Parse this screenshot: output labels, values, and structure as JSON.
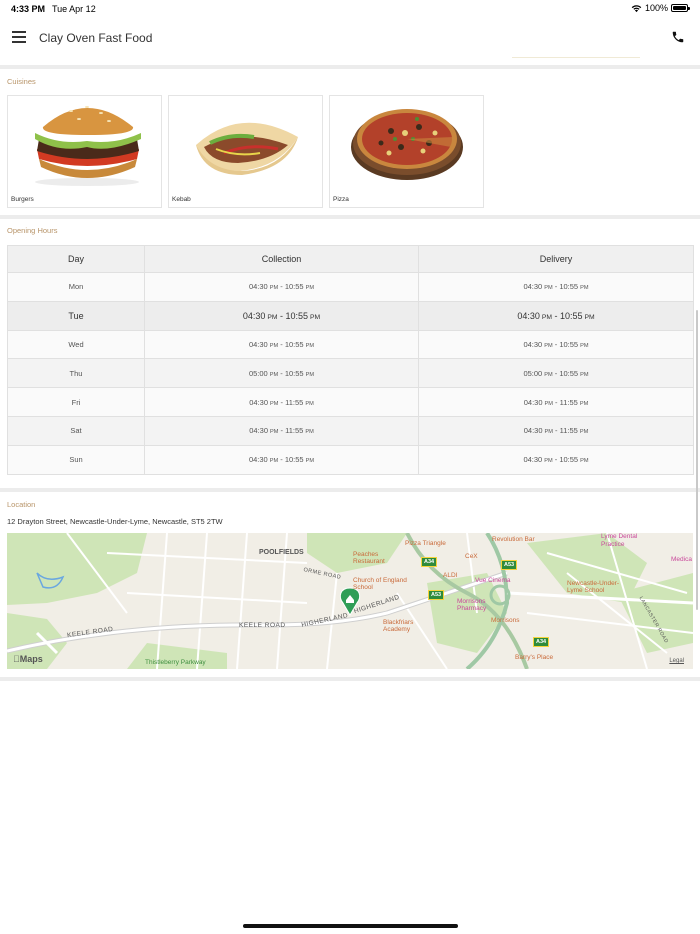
{
  "status_bar": {
    "time": "4:33 PM",
    "date": "Tue Apr 12",
    "battery": "100%"
  },
  "header": {
    "title": "Clay Oven Fast Food",
    "menu_icon": "hamburger-menu-icon",
    "phone_icon": "phone-icon"
  },
  "cuisines": {
    "label": "Cuisines",
    "items": [
      {
        "name": "Burgers",
        "icon": "burger-image"
      },
      {
        "name": "Kebab",
        "icon": "kebab-image"
      },
      {
        "name": "Pizza",
        "icon": "pizza-image"
      }
    ]
  },
  "opening_hours": {
    "label": "Opening Hours",
    "columns": [
      "Day",
      "Collection",
      "Delivery"
    ],
    "rows": [
      {
        "day": "Mon",
        "col_open": "04:30",
        "col_close": "10:55",
        "del_open": "04:30",
        "del_close": "10:55"
      },
      {
        "day": "Tue",
        "col_open": "04:30",
        "col_close": "10:55",
        "del_open": "04:30",
        "del_close": "10:55"
      },
      {
        "day": "Wed",
        "col_open": "04:30",
        "col_close": "10:55",
        "del_open": "04:30",
        "del_close": "10:55"
      },
      {
        "day": "Thu",
        "col_open": "05:00",
        "col_close": "10:55",
        "del_open": "05:00",
        "del_close": "10:55"
      },
      {
        "day": "Fri",
        "col_open": "04:30",
        "col_close": "11:55",
        "del_open": "04:30",
        "del_close": "11:55"
      },
      {
        "day": "Sat",
        "col_open": "04:30",
        "col_close": "11:55",
        "del_open": "04:30",
        "del_close": "11:55"
      },
      {
        "day": "Sun",
        "col_open": "04:30",
        "col_close": "10:55",
        "del_open": "04:30",
        "del_close": "10:55"
      }
    ],
    "pm": "PM",
    "separator": " - "
  },
  "location": {
    "label": "Location",
    "address": "12 Drayton Street, Newcastle-Under-Lyme, Newcastle, ST5 2TW",
    "map": {
      "area": "POOLFIELDS",
      "pois": {
        "pizza_triangle": "Pizza Triangle",
        "revolution_bar": "Revolution Bar",
        "lyme_dental": "Lyme Dental Practice",
        "medical": "Medica",
        "peaches": "Peaches Restaurant",
        "cex": "CeX",
        "church_school": "Church of England School",
        "aldi": "ALDI",
        "vue": "Vue Cinema",
        "nul_school": "Newcastle-Under-Lyme School",
        "morrisons_pharmacy": "Morrisons Pharmacy",
        "blackfriars": "Blackfriars Academy",
        "morrisons": "Morrisons",
        "barrys": "Barry's Place",
        "thistleberry": "Thistleberry Parkway"
      },
      "roads": {
        "keele1": "KEELE ROAD",
        "keele2": "KEELE ROAD",
        "higherland1": "HIGHERLAND",
        "higherland2": "HIGHERLAND",
        "orme": "ORME ROAD",
        "lancaster": "LANCASTER ROAD",
        "oriel": "ORME RD",
        "wesley": "WESLEY PL",
        "palmerston": "PALMERSTON",
        "hillside": "HILLSIDE",
        "thistleberry_ave": "THISTLEBERRY AVE",
        "seabridge": "SEABRIDGE RD",
        "the_ave": "THE AVE"
      },
      "shields": {
        "a34a": "A34",
        "a53a": "A53",
        "a53b": "A53",
        "a34b": "A34"
      },
      "maps_logo": "Maps",
      "legal": "Legal"
    }
  },
  "colors": {
    "accent_label": "#b8956a",
    "map_pin": "#2f9e57",
    "road_shield": "#2f8b3b"
  }
}
